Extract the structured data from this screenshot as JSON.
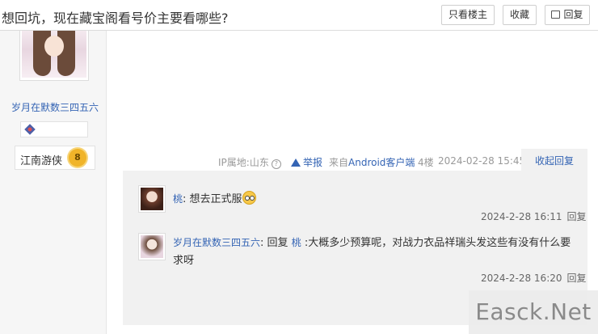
{
  "header": {
    "title": "想回坑，现在藏宝阁看号价主要看哪些?",
    "only_op_label": "只看楼主",
    "favorite_label": "收藏",
    "reply_label": "回复"
  },
  "author": {
    "name": "岁月在默数三四五六",
    "level_title": "江南游侠",
    "level": "8"
  },
  "post_meta": {
    "ip": "IP属地:山东",
    "help_icon_glyph": "?",
    "report": "举报",
    "from_prefix": "来自",
    "client": "Android客户端",
    "floor": "4楼",
    "time": "2024-02-28 15:45",
    "collapse_replies": "收起回复"
  },
  "comments": [
    {
      "user": "桃",
      "separator": ":",
      "text": "想去正式服",
      "emoji": "shocked-face-icon",
      "time": "2024-2-28 16:11",
      "reply_label": "回复"
    },
    {
      "user": "岁月在默数三四五六",
      "separator": ":",
      "reply_word": "回复",
      "reply_to": "桃",
      "text": ":大概多少预算呢，对战力衣品祥瑞头发这些有没有什么要求呀",
      "time": "2024-2-28 16:20",
      "reply_label": "回复"
    }
  ],
  "watermark": "Easck.Net",
  "colors": {
    "link_blue": "#3464b4",
    "panel_gray": "#f1f1f1",
    "level_gold": "#f0b429"
  }
}
